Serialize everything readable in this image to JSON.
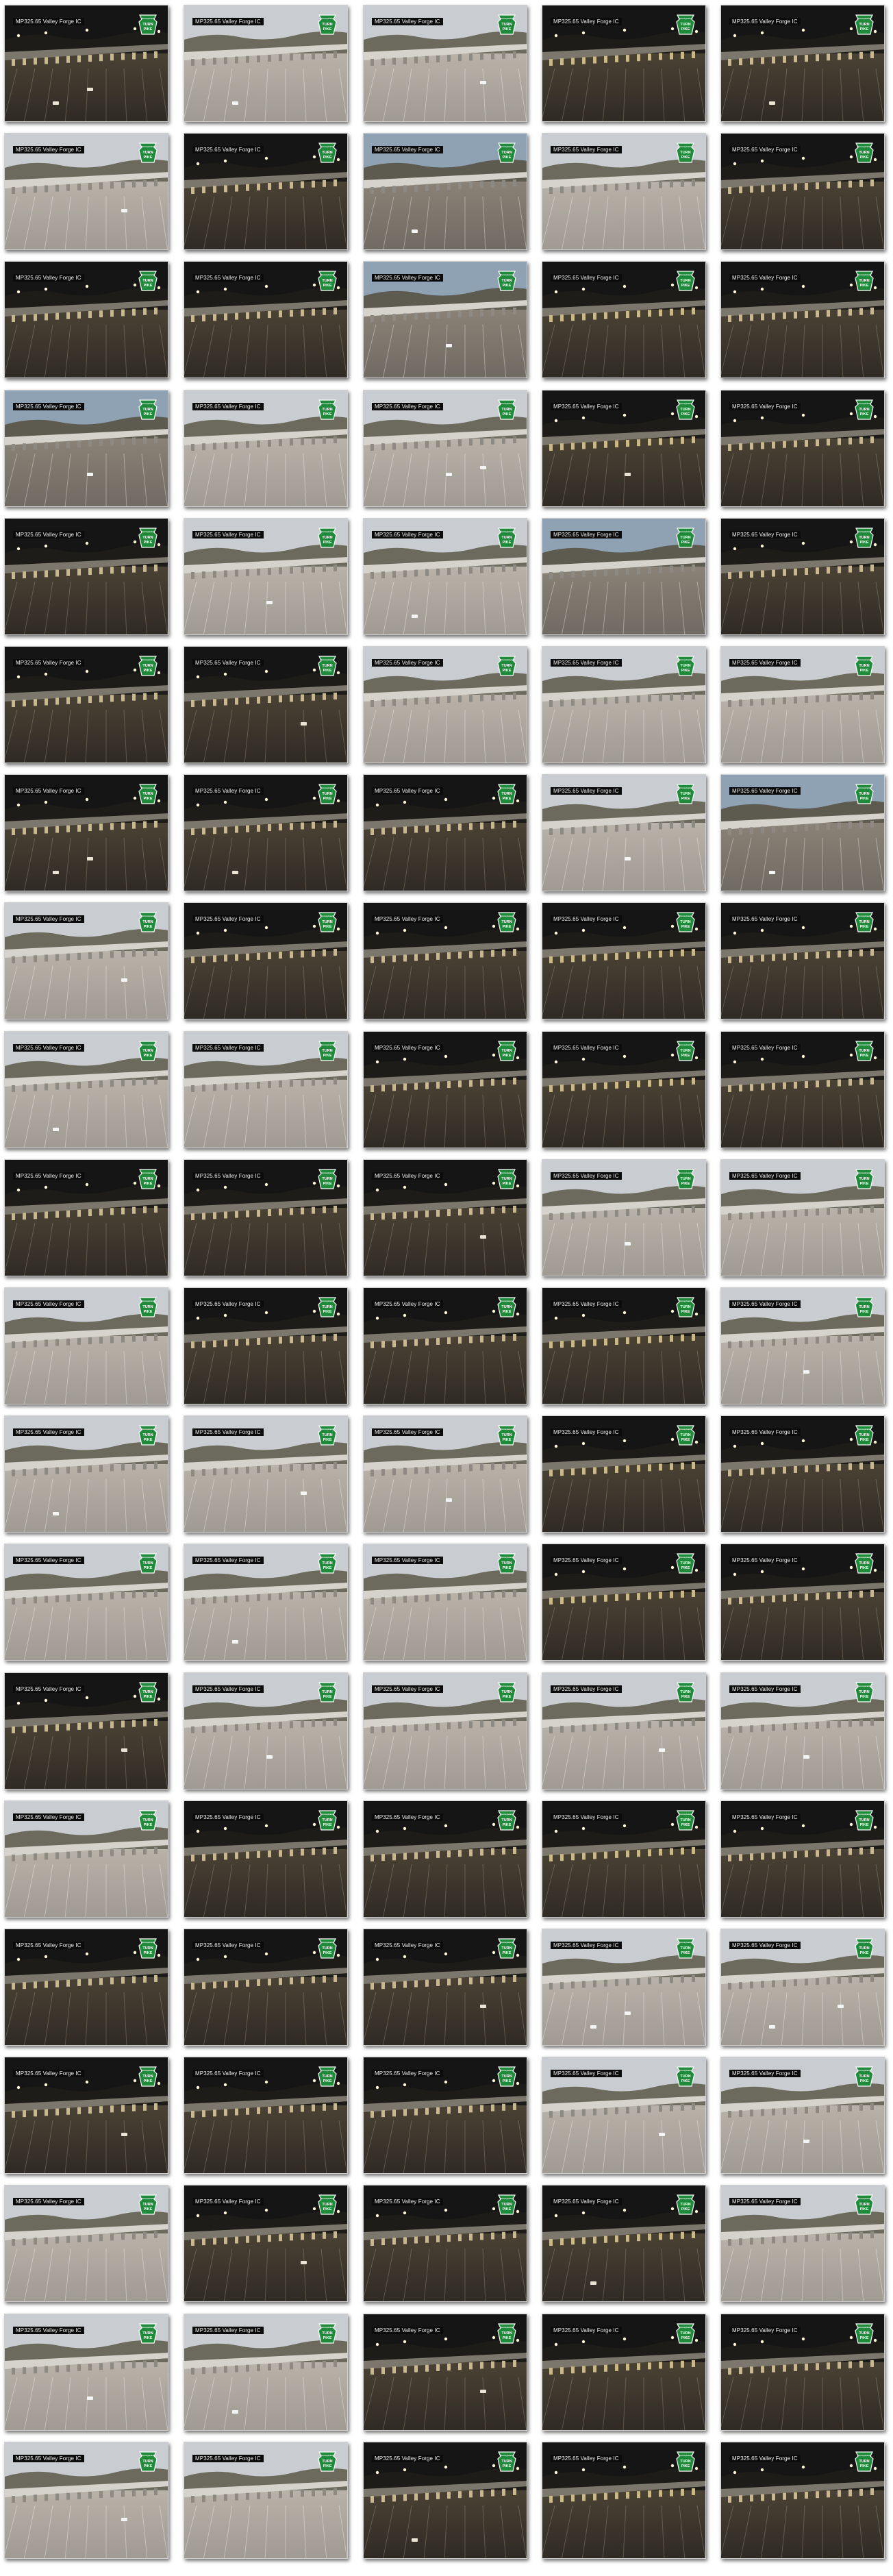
{
  "layout": {
    "columns": 5,
    "rows": 20
  },
  "camera_label": "MP325.65 Valley Forge IC",
  "logo_text": [
    "Pennsylvania",
    "TURN",
    "PIKE"
  ],
  "colors": {
    "logo_green": "#1f8a3a",
    "label_bg": "#0b0b0b",
    "label_text": "#f2f2f2",
    "night_sky": "#151515",
    "day_sky": "#c9ccd0",
    "dusk_sky": "#8fa2b3"
  },
  "frames": [
    {
      "light": "night",
      "vehicles": 2
    },
    {
      "light": "day",
      "vehicles": 1
    },
    {
      "light": "day",
      "vehicles": 1
    },
    {
      "light": "night",
      "vehicles": 0
    },
    {
      "light": "night",
      "vehicles": 1
    },
    {
      "light": "day",
      "vehicles": 1
    },
    {
      "light": "night",
      "vehicles": 0
    },
    {
      "light": "dusk",
      "vehicles": 1
    },
    {
      "light": "day",
      "vehicles": 0
    },
    {
      "light": "night",
      "vehicles": 0
    },
    {
      "light": "night",
      "vehicles": 0
    },
    {
      "light": "night",
      "vehicles": 0
    },
    {
      "light": "dusk",
      "vehicles": 1
    },
    {
      "light": "night",
      "vehicles": 0
    },
    {
      "light": "night",
      "vehicles": 0
    },
    {
      "light": "dusk",
      "vehicles": 1
    },
    {
      "light": "day",
      "vehicles": 0
    },
    {
      "light": "day",
      "vehicles": 2
    },
    {
      "light": "night",
      "vehicles": 1
    },
    {
      "light": "night",
      "vehicles": 0
    },
    {
      "light": "night",
      "vehicles": 0
    },
    {
      "light": "day",
      "vehicles": 1
    },
    {
      "light": "day",
      "vehicles": 1
    },
    {
      "light": "dusk",
      "vehicles": 0
    },
    {
      "light": "night",
      "vehicles": 0
    },
    {
      "light": "night",
      "vehicles": 0
    },
    {
      "light": "night",
      "vehicles": 1
    },
    {
      "light": "day",
      "vehicles": 0
    },
    {
      "light": "day",
      "vehicles": 0
    },
    {
      "light": "day",
      "vehicles": 0
    },
    {
      "light": "night",
      "vehicles": 2
    },
    {
      "light": "night",
      "vehicles": 1
    },
    {
      "light": "night",
      "vehicles": 0
    },
    {
      "light": "day",
      "vehicles": 1
    },
    {
      "light": "dusk",
      "vehicles": 1
    },
    {
      "light": "day",
      "vehicles": 1
    },
    {
      "light": "night",
      "vehicles": 0
    },
    {
      "light": "night",
      "vehicles": 0
    },
    {
      "light": "night",
      "vehicles": 0
    },
    {
      "light": "night",
      "vehicles": 0
    },
    {
      "light": "day",
      "vehicles": 1
    },
    {
      "light": "day",
      "vehicles": 0
    },
    {
      "light": "night",
      "vehicles": 0
    },
    {
      "light": "night",
      "vehicles": 0
    },
    {
      "light": "night",
      "vehicles": 0
    },
    {
      "light": "night",
      "vehicles": 0
    },
    {
      "light": "night",
      "vehicles": 0
    },
    {
      "light": "night",
      "vehicles": 1
    },
    {
      "light": "day",
      "vehicles": 1
    },
    {
      "light": "day",
      "vehicles": 0
    },
    {
      "light": "day",
      "vehicles": 0
    },
    {
      "light": "night",
      "vehicles": 0
    },
    {
      "light": "night",
      "vehicles": 0
    },
    {
      "light": "night",
      "vehicles": 0
    },
    {
      "light": "day",
      "vehicles": 1
    },
    {
      "light": "day",
      "vehicles": 1
    },
    {
      "light": "day",
      "vehicles": 1
    },
    {
      "light": "day",
      "vehicles": 1
    },
    {
      "light": "night",
      "vehicles": 0
    },
    {
      "light": "night",
      "vehicles": 0
    },
    {
      "light": "day",
      "vehicles": 0
    },
    {
      "light": "day",
      "vehicles": 1
    },
    {
      "light": "day",
      "vehicles": 0
    },
    {
      "light": "night",
      "vehicles": 0
    },
    {
      "light": "night",
      "vehicles": 0
    },
    {
      "light": "night",
      "vehicles": 1
    },
    {
      "light": "day",
      "vehicles": 1
    },
    {
      "light": "day",
      "vehicles": 0
    },
    {
      "light": "day",
      "vehicles": 1
    },
    {
      "light": "day",
      "vehicles": 1
    },
    {
      "light": "day",
      "vehicles": 0
    },
    {
      "light": "night",
      "vehicles": 0
    },
    {
      "light": "night",
      "vehicles": 0
    },
    {
      "light": "night",
      "vehicles": 0
    },
    {
      "light": "night",
      "vehicles": 0
    },
    {
      "light": "night",
      "vehicles": 0
    },
    {
      "light": "night",
      "vehicles": 0
    },
    {
      "light": "night",
      "vehicles": 1
    },
    {
      "light": "day",
      "vehicles": 2
    },
    {
      "light": "day",
      "vehicles": 2
    },
    {
      "light": "night",
      "vehicles": 1
    },
    {
      "light": "night",
      "vehicles": 0
    },
    {
      "light": "night",
      "vehicles": 0
    },
    {
      "light": "day",
      "vehicles": 1
    },
    {
      "light": "day",
      "vehicles": 1
    },
    {
      "light": "day",
      "vehicles": 0
    },
    {
      "light": "night",
      "vehicles": 1
    },
    {
      "light": "night",
      "vehicles": 0
    },
    {
      "light": "night",
      "vehicles": 1
    },
    {
      "light": "day",
      "vehicles": 0
    },
    {
      "light": "day",
      "vehicles": 1
    },
    {
      "light": "day",
      "vehicles": 1
    },
    {
      "light": "night",
      "vehicles": 1
    },
    {
      "light": "night",
      "vehicles": 0
    },
    {
      "light": "night",
      "vehicles": 0
    },
    {
      "light": "day",
      "vehicles": 1
    },
    {
      "light": "day",
      "vehicles": 0
    },
    {
      "light": "night",
      "vehicles": 1
    },
    {
      "light": "night",
      "vehicles": 0
    },
    {
      "light": "night",
      "vehicles": 0
    }
  ]
}
